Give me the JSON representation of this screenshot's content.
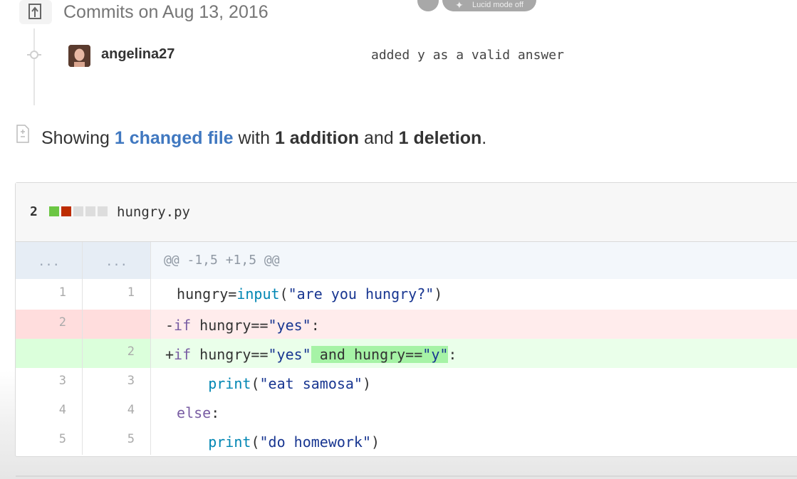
{
  "commits": {
    "header": "Commits on Aug 13, 2016",
    "author": "angelina27",
    "message": "added y as a valid answer"
  },
  "toolbar": {
    "mode_label": "Lucid mode off"
  },
  "summary": {
    "prefix": "Showing ",
    "changed": "1 changed file",
    "with": " with ",
    "additions": "1 addition",
    "and": " and ",
    "deletions": "1 deletion",
    "end": "."
  },
  "file": {
    "change_count": "2",
    "name": "hungry.py",
    "colors": {
      "addition": "#6cc644",
      "deletion": "#bd2c00",
      "neutral": "#dddddd"
    }
  },
  "diff": {
    "hunk": {
      "old": "...",
      "new": "...",
      "text": "@@ -1,5 +1,5 @@"
    },
    "rows": [
      {
        "old": "1",
        "new": "1"
      },
      {
        "old": "2",
        "new": ""
      },
      {
        "old": "",
        "new": "2"
      },
      {
        "old": "3",
        "new": "3"
      },
      {
        "old": "4",
        "new": "4"
      },
      {
        "old": "5",
        "new": "5"
      }
    ],
    "code": {
      "l1_a": " hungry=",
      "l1_fn": "input",
      "l1_b": "(",
      "l1_str": "\"are you hungry?\"",
      "l1_c": ")",
      "l2_a": "-",
      "l2_kw": "if",
      "l2_b": " hungry==",
      "l2_str": "\"yes\"",
      "l2_c": ":",
      "l3_a": "+",
      "l3_kw": "if",
      "l3_b": " hungry==",
      "l3_str": "\"yes\"",
      "l3_hl_a": " and hungry==",
      "l3_hl_str": "\"y\"",
      "l3_c": ":",
      "l4_a": "     ",
      "l4_fn": "print",
      "l4_b": "(",
      "l4_str": "\"eat samosa\"",
      "l4_c": ")",
      "l5_a": " ",
      "l5_kw": "else",
      "l5_b": ":",
      "l6_a": "     ",
      "l6_fn": "print",
      "l6_b": "(",
      "l6_str": "\"do homework\"",
      "l6_c": ")"
    },
    "colors": {
      "deletion_bg": "#ffecec",
      "deletion_gutter": "#ffdddd",
      "addition_bg": "#eaffea",
      "addition_gutter": "#dbffdb",
      "hunk_bg": "#f3f7fb",
      "hunk_gutter": "#e6edf5"
    }
  }
}
